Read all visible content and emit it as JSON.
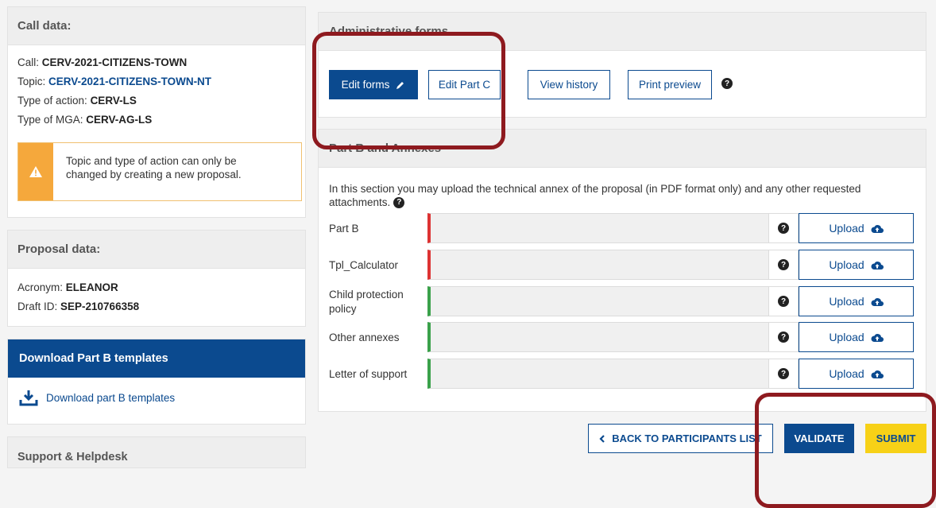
{
  "call": {
    "header": "Call data:",
    "call_label": "Call: ",
    "call_value": "CERV-2021-CITIZENS-TOWN",
    "topic_label": "Topic: ",
    "topic_value": "CERV-2021-CITIZENS-TOWN-NT",
    "action_label": "Type of action: ",
    "action_value": "CERV-LS",
    "mga_label": "Type of MGA: ",
    "mga_value": "CERV-AG-LS",
    "warning_line1": "Topic and type of action can only be",
    "warning_line2": "changed by creating a new proposal."
  },
  "proposal": {
    "header": "Proposal data:",
    "acronym_label": "Acronym: ",
    "acronym_value": "ELEANOR",
    "draft_label": "Draft ID: ",
    "draft_value": "SEP-210766358"
  },
  "download": {
    "header": "Download Part B templates",
    "link": "Download part B templates"
  },
  "support": {
    "header": "Support & Helpdesk"
  },
  "admin": {
    "header": "Administrative forms",
    "edit_forms": "Edit forms",
    "edit_part_c": "Edit Part C",
    "view_history": "View history",
    "print_preview": "Print preview"
  },
  "partb": {
    "header": "Part B and Annexes",
    "intro_line1": "In this section you may upload the technical annex of the proposal (in PDF format only) and any other requested",
    "intro_line2": "attachments.",
    "rows": [
      {
        "label": "Part B",
        "status": "missing",
        "upload": "Upload"
      },
      {
        "label": "Tpl_Calculator",
        "status": "missing",
        "upload": "Upload"
      },
      {
        "label_line1": "Child protection",
        "label_line2": "policy",
        "status": "ok",
        "upload": "Upload"
      },
      {
        "label": "Other annexes",
        "status": "ok",
        "upload": "Upload"
      },
      {
        "label": "Letter of support",
        "status": "ok",
        "upload": "Upload"
      }
    ]
  },
  "footer": {
    "back": "BACK TO PARTICIPANTS LIST",
    "validate": "VALIDATE",
    "submit": "SUBMIT"
  },
  "icons": {
    "help": "?",
    "colors": {
      "primary": "#0b4a8f",
      "warning": "#f5a83c",
      "missing": "#dd3333",
      "ok": "#3aa14a",
      "submit": "#f7d117",
      "annotation": "#8e1a1f"
    }
  }
}
